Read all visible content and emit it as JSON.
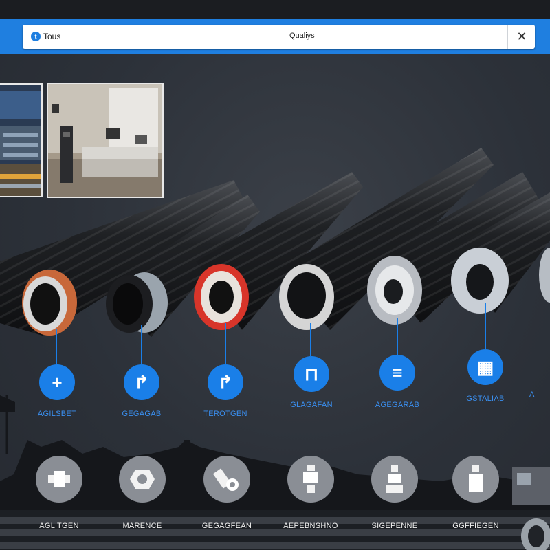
{
  "browser": {
    "tab_label": "Tous",
    "center_title": "Qualiys",
    "close_symbol": "✕",
    "logo_glyph": "t"
  },
  "photos": [
    {
      "name": "factory-photo"
    },
    {
      "name": "lab-photo"
    }
  ],
  "pipes": [
    {
      "name": "pipe-orange-sheath",
      "accent": "#c8683a"
    },
    {
      "name": "pipe-steel-collar",
      "accent": "#9aa4ad"
    },
    {
      "name": "pipe-red-ring",
      "accent": "#d8352a"
    },
    {
      "name": "pipe-white-core",
      "accent": "#d5d5d5"
    },
    {
      "name": "pipe-wire-braid",
      "accent": "#b8bcc2"
    },
    {
      "name": "pipe-white-bore",
      "accent": "#c9cfd6"
    }
  ],
  "features": [
    {
      "label": "AGILSBET",
      "icon": "plus-icon",
      "glyph": "+"
    },
    {
      "label": "GEGAGAB",
      "icon": "elbow-icon",
      "glyph": "↱"
    },
    {
      "label": "TEROTGEN",
      "icon": "bend-icon",
      "glyph": "↱"
    },
    {
      "label": "GLAGAFAN",
      "icon": "cap-icon",
      "glyph": "⊓"
    },
    {
      "label": "AGEGARAB",
      "icon": "spring-icon",
      "glyph": "≡"
    },
    {
      "label": "GSTALIAB",
      "icon": "box-icon",
      "glyph": "▦"
    },
    {
      "label": "A",
      "icon": "partial-icon",
      "glyph": ""
    }
  ],
  "fittings": [
    {
      "label": "AGL TGEN",
      "icon": "coupling-icon"
    },
    {
      "label": "MARENCE",
      "icon": "nut-icon"
    },
    {
      "label": "GEGAGFEAN",
      "icon": "elbow-fitting-icon"
    },
    {
      "label": "AEPEBNSHNO",
      "icon": "valve-icon"
    },
    {
      "label": "SIGEPENNE",
      "icon": "adapter-icon"
    },
    {
      "label": "GGFFIEGEN",
      "icon": "plug-icon"
    }
  ],
  "colors": {
    "brand": "#1f7fe0",
    "accent_icon": "#1a7fe8",
    "label_blue": "#3a8ff0",
    "background": "#2c3139"
  }
}
